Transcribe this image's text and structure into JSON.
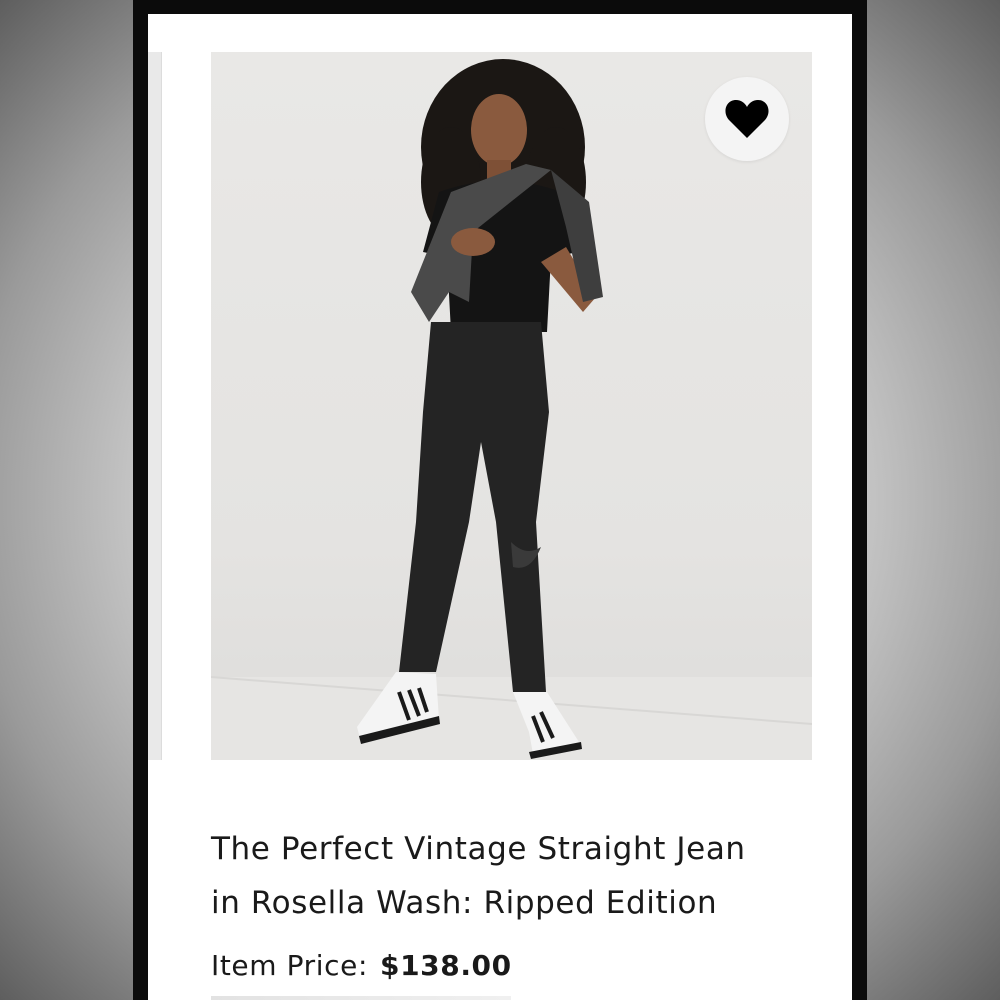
{
  "product": {
    "title_line1": "The Perfect Vintage Straight Jean",
    "title_line2": "in Rosella Wash: Ripped Edition",
    "price_label": "Item Price:",
    "price_value": "$138.00",
    "favorited": true
  },
  "icons": {
    "favorite": "heart-icon"
  },
  "colors": {
    "heart": "#000000",
    "text": "#1a1a1a",
    "screen_bg": "#ffffff"
  }
}
